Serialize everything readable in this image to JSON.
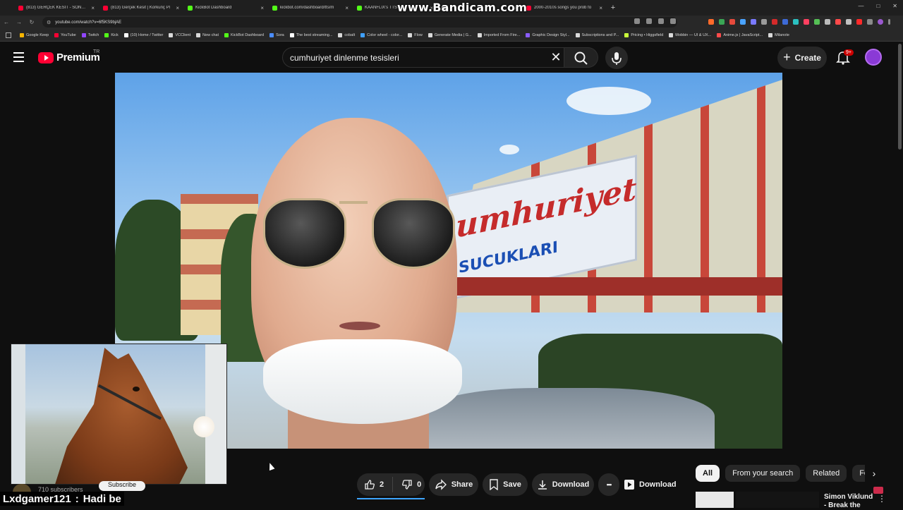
{
  "browser": {
    "tabs": [
      {
        "title": "(813) GERÇEK KESİT - SONUN İ",
        "color": "#ff0033"
      },
      {
        "title": "(813) Gerçek Kesit | Korkunç Pl",
        "color": "#ff0033"
      },
      {
        "title": "KickBot Dashboard",
        "color": "#53fc18"
      },
      {
        "title": "kickbot.com/dashboard/tts/m",
        "color": "#53fc18"
      },
      {
        "title": "KAANFLIX's TTS Vol",
        "color": "#53fc18"
      },
      {
        "title": "",
        "color": "#ffffff"
      },
      {
        "title": "2000-2010s songs you prob fo",
        "color": "#ff0033"
      }
    ],
    "new_tab_label": "+",
    "watermark": "www.Bandicam.com",
    "url": "youtube.com/watch?v=6f5KS9bjAE",
    "bookmarks": [
      {
        "label": "Google Keep",
        "color": "#f6b400"
      },
      {
        "label": "YouTube",
        "color": "#ff0033"
      },
      {
        "label": "Twitch",
        "color": "#9146ff"
      },
      {
        "label": "Kick",
        "color": "#53fc18"
      },
      {
        "label": "(10) Home / Twitter",
        "color": "#ffffff"
      },
      {
        "label": "VCClient",
        "color": "#d9d9d9"
      },
      {
        "label": "New chat",
        "color": "#d9d9d9"
      },
      {
        "label": "KickBot Dashboard",
        "color": "#53fc18"
      },
      {
        "label": "Sora",
        "color": "#4a8cff"
      },
      {
        "label": "The best streaming...",
        "color": "#ffffff"
      },
      {
        "label": "cobalt",
        "color": "#d9d9d9"
      },
      {
        "label": "Color wheel - color...",
        "color": "#3fa0ff"
      },
      {
        "label": "Flow",
        "color": "#d9d9d9"
      },
      {
        "label": "Generate Media | G...",
        "color": "#d9d9d9"
      },
      {
        "label": "Imported From Fire...",
        "color": "#d9d9d9"
      },
      {
        "label": "Graphic Design Styl...",
        "color": "#8a5cff"
      },
      {
        "label": "Subscriptions and P...",
        "color": "#d9d9d9"
      },
      {
        "label": "Pricing • Higgsfield",
        "color": "#c9ff3a"
      },
      {
        "label": "Mobbin — UI & UX...",
        "color": "#d9d9d9"
      },
      {
        "label": "Anime.js | JavaScript...",
        "color": "#ff4b4b"
      },
      {
        "label": "Milanote",
        "color": "#d9d9d9"
      }
    ]
  },
  "header": {
    "logo_text": "Premium",
    "country_code": "TR",
    "search_value": "cumhuriyet dinlenme tesisleri",
    "create_label": "Create",
    "notif_badge": "9+"
  },
  "video": {
    "sign_line1": "umhuriyet",
    "sign_line2": "SUCUKLARI"
  },
  "overlay": {
    "subscriber_text": "710 subscribers",
    "subscribe_label": "Subscribe",
    "chat_user": "Lxdgamer121",
    "chat_sep": ":",
    "chat_message": "Hadi be"
  },
  "actions": {
    "like_count": "2",
    "dislike_count": "0",
    "share_label": "Share",
    "save_label": "Save",
    "download_label": "Download",
    "more_label": "•••",
    "premium_download_label": "Download"
  },
  "chips": [
    "All",
    "From your search",
    "Related",
    "For"
  ],
  "recommendation": {
    "title": "Simon Viklund - Break the",
    "more": "⋮"
  }
}
